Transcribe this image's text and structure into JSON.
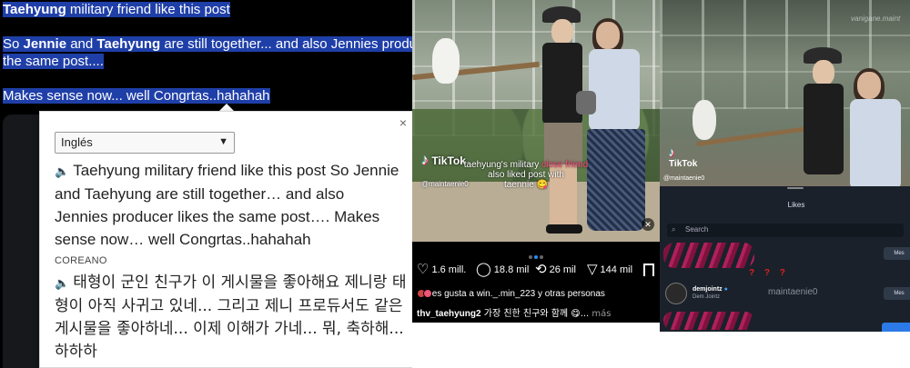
{
  "tweet": {
    "line1_bold": "Taehyung",
    "line1_rest": " military friend like this post",
    "line2_pre": "So ",
    "line2_bold1": "Jennie",
    "line2_mid": " and ",
    "line2_bold2": "Taehyung",
    "line2_rest": " are still together... and also Jennies producer",
    "line3": "the same post....",
    "line4": "Makes sense now... well Congrtas..hahahah"
  },
  "translator": {
    "close": "×",
    "target_language": "Inglés",
    "speaker_icon": "🔈",
    "translation": "Taehyung military friend like this post So Jennie and Taehyung are still together… and also Jennies producer likes the same post…. Makes sense now… well Congrtas..hahahah",
    "source_language": "COREANO",
    "source_text": "태형이 군인 친구가 이 게시물을 좋아해요 제니랑 태형이 아직 사귀고 있네... 그리고 제니 프로듀서도 같은 게시물을 좋아하네... 이제 이해가 가네... 뭐, 축하해... 하하하"
  },
  "instagram": {
    "tiktok_brand": "TikTok",
    "tiktok_user": "@maintaenie0",
    "overlay_line1_a": "taehyung's military ",
    "overlay_line1_pink": "close friend",
    "overlay_line2": "also liked post with",
    "overlay_line3": "taennie 😋",
    "likes_count": "1.6 mill.",
    "comments_count": "18.8 mil",
    "reposts_count": "26 mil",
    "shares_count": "144 mil",
    "liked_by": "es gusta a win._.min_223 y otras personas",
    "caption_user": "thv_taehyung2",
    "caption_text": " 가장 친한 친구와 함께 😋...",
    "caption_more": " más"
  },
  "tiktok_panel": {
    "watermark": "vanigane.maint",
    "brand": "TikTok",
    "user": "@maintaenie0",
    "sheet_title": "Likes",
    "search_placeholder": "Search",
    "row_user": "demjointz",
    "row_sub": "Dem Jointz",
    "row_button": "Mes",
    "question_marks": "? ? ?",
    "annotation": "maintaenie0"
  },
  "colors": {
    "highlight": "#1f3fa8",
    "accent_blue": "#2b8af8",
    "tiktok_pink": "#ee1d52",
    "annotation_red": "#e02020"
  }
}
